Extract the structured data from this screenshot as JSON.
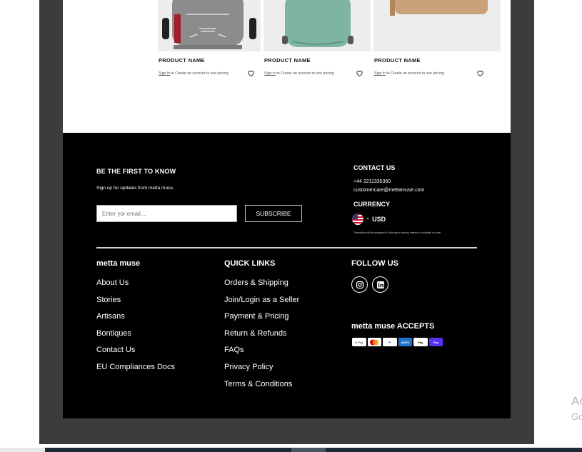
{
  "products": [
    {
      "name": "PRODUCT NAME",
      "sign_link": "Sign in",
      "sign_text": " to Create an account to see pricing"
    },
    {
      "name": "PRODUCT NAME",
      "sign_link": "Sign in",
      "sign_text": " to Create an account to see pricing"
    },
    {
      "name": "PRODUCT NAME",
      "sign_link": "Sign in",
      "sign_text": " to Create an account to see pricing"
    }
  ],
  "newsletter": {
    "title": "BE THE FIRST TO KNOW",
    "subtitle": "Sign up for updates from metta muse.",
    "placeholder": "Enter yor email....",
    "button": "SUBSCRIBE"
  },
  "contact": {
    "title": "CONTACT US",
    "phone": "+44 2211335360",
    "email": "customercare@mettamuse.com"
  },
  "currency": {
    "title": "CURRENCY",
    "value": "USD",
    "caret": "•",
    "note": "Transactions will be completed in Euros and a currency reference is available on hover."
  },
  "columns": {
    "brand": {
      "title": "metta muse",
      "links": [
        "About Us",
        "Stories",
        "Artisans",
        "Bontiques",
        "Contact Us",
        "EU Compliances Docs"
      ]
    },
    "quick": {
      "title": "QUICK LINKS",
      "links": [
        "Orders & Shipping",
        "Join/Login as a Seller",
        "Payment & Pricing",
        "Return & Refunds",
        "FAQs",
        "Privacy Policy",
        "Terms & Conditions"
      ]
    }
  },
  "follow": {
    "title": "FOLLOW US",
    "icons": [
      "instagram-icon",
      "linkedin-icon"
    ]
  },
  "accepts": {
    "title": "metta muse ACCEPTS",
    "methods": [
      {
        "label": "G Pay",
        "bg": "#ffffff",
        "fg": "#5f6368"
      },
      {
        "label": "",
        "bg": "#ffffff",
        "fg": "#eb001b"
      },
      {
        "label": "P",
        "bg": "#ffffff",
        "fg": "#003087"
      },
      {
        "label": "AMEX",
        "bg": "#1f72cd",
        "fg": "#ffffff"
      },
      {
        "label": "Pay",
        "bg": "#ffffff",
        "fg": "#000000"
      },
      {
        "label": "Pay",
        "bg": "#5a31f4",
        "fg": "#ffffff"
      }
    ]
  },
  "ghost": {
    "line1": "Ac",
    "line2": "Go"
  },
  "colors": {
    "footer_bg": "#000000",
    "frame_bg": "#3c3c3c",
    "text_light": "#ffffff"
  }
}
